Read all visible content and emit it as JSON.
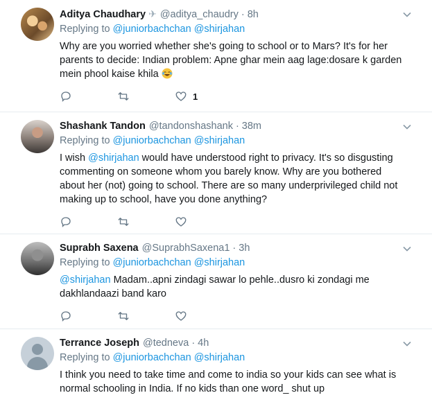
{
  "tweets": [
    {
      "name": "Aditya Chaudhary",
      "badge_icon": "airplane-icon",
      "handle": "@aditya_chaudry",
      "time": "8h",
      "reply_prefix": "Replying to",
      "mentions": [
        "@juniorbachchan",
        "@shirjahan"
      ],
      "text_plain": "Why are you worried whether she's going to school or to Mars? It's for her parents to decide: Indian problem: Apne ghar mein aag lage:dosare k garden mein phool kaise khila",
      "emoji": "laughing-tears-emoji",
      "like_count": "1"
    },
    {
      "name": "Shashank Tandon",
      "handle": "@tandonshashank",
      "time": "38m",
      "reply_prefix": "Replying to",
      "mentions": [
        "@juniorbachchan",
        "@shirjahan"
      ],
      "text_lead": "I wish ",
      "text_mention": "@shirjahan",
      "text_rest": " would have understood right to privacy. It's so disgusting commenting on someone whom you barely know. Why are you bothered about her (not) going to school. There are so many underprivileged child not making up to school, have you done anything?"
    },
    {
      "name": "Suprabh Saxena",
      "handle": "@SuprabhSaxena1",
      "time": "3h",
      "reply_prefix": "Replying to",
      "mentions": [
        "@juniorbachchan",
        "@shirjahan"
      ],
      "text_mention": "@shirjahan",
      "text_rest": " Madam..apni zindagi sawar lo pehle..dusro ki zondagi me dakhlandaazi band karo"
    },
    {
      "name": "Terrance Joseph",
      "handle": "@tedneva",
      "time": "4h",
      "reply_prefix": "Replying to",
      "mentions": [
        "@juniorbachchan",
        "@shirjahan"
      ],
      "text_plain": "I think you need to take time and come to india so your kids can see what is normal schooling in India. If no kids than one word_ shut up"
    }
  ],
  "separator": "·",
  "icons": [
    "reply-icon",
    "retweet-icon",
    "like-icon",
    "caret-down-icon"
  ],
  "colors": {
    "link": "#1b95e0",
    "muted": "#657786",
    "text": "#14171a",
    "divider": "#e6ecf0"
  }
}
